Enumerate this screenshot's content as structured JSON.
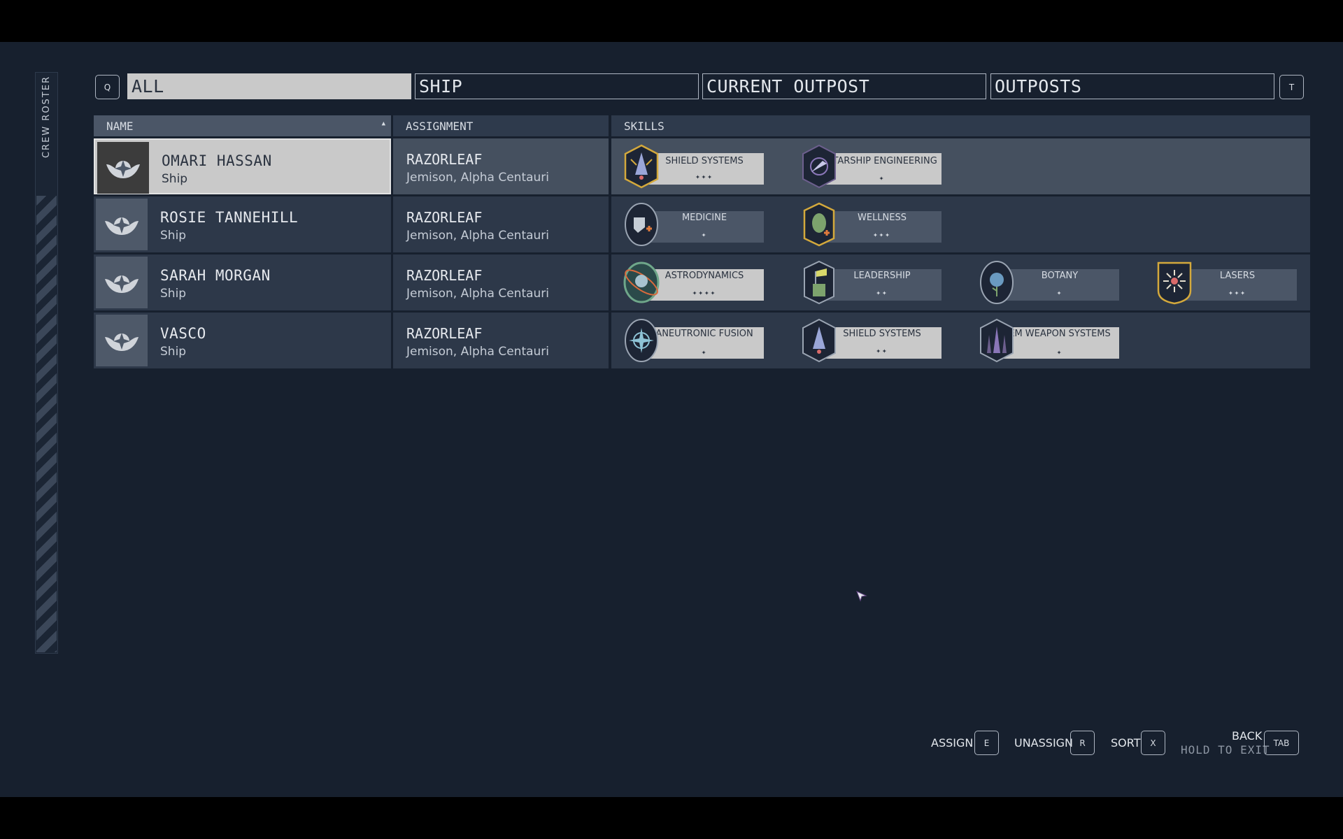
{
  "side_panel": {
    "label": "CREW ROSTER"
  },
  "tabs": {
    "prev_key": "Q",
    "next_key": "T",
    "items": [
      {
        "label": "ALL",
        "active": true
      },
      {
        "label": "SHIP",
        "active": false
      },
      {
        "label": "CURRENT OUTPOST",
        "active": false
      },
      {
        "label": "OUTPOSTS",
        "active": false
      }
    ]
  },
  "table": {
    "headers": {
      "name": "NAME",
      "assignment": "ASSIGNMENT",
      "skills": "SKILLS"
    },
    "rows": [
      {
        "name": "OMARI HASSAN",
        "location": "Ship",
        "ship": "RAZORLEAF",
        "place": "Jemison, Alpha Centauri",
        "selected": true,
        "skills": [
          {
            "name": "SHIELD SYSTEMS",
            "rank": "✦✦✦",
            "rank_value": 3,
            "icon": "shield-systems-patch-icon"
          },
          {
            "name": "STARSHIP ENGINEERING",
            "rank": "✦",
            "rank_value": 1,
            "icon": "starship-engineering-patch-icon"
          }
        ]
      },
      {
        "name": "ROSIE TANNEHILL",
        "location": "Ship",
        "ship": "RAZORLEAF",
        "place": "Jemison, Alpha Centauri",
        "selected": false,
        "skills": [
          {
            "name": "MEDICINE",
            "rank": "✦",
            "rank_value": 1,
            "icon": "medicine-patch-icon"
          },
          {
            "name": "WELLNESS",
            "rank": "✦✦✦",
            "rank_value": 3,
            "icon": "wellness-patch-icon"
          }
        ]
      },
      {
        "name": "SARAH MORGAN",
        "location": "Ship",
        "ship": "RAZORLEAF",
        "place": "Jemison, Alpha Centauri",
        "selected": false,
        "skills": [
          {
            "name": "ASTRODYNAMICS",
            "rank": "✦✦✦✦",
            "rank_value": 4,
            "icon": "astrodynamics-patch-icon"
          },
          {
            "name": "LEADERSHIP",
            "rank": "✦✦",
            "rank_value": 2,
            "icon": "leadership-patch-icon"
          },
          {
            "name": "BOTANY",
            "rank": "✦",
            "rank_value": 1,
            "icon": "botany-patch-icon"
          },
          {
            "name": "LASERS",
            "rank": "✦✦✦",
            "rank_value": 3,
            "icon": "lasers-patch-icon"
          }
        ]
      },
      {
        "name": "VASCO",
        "location": "Ship",
        "ship": "RAZORLEAF",
        "place": "Jemison, Alpha Centauri",
        "selected": false,
        "skills": [
          {
            "name": "ANEUTRONIC FUSION",
            "rank": "✦",
            "rank_value": 1,
            "icon": "aneutronic-fusion-patch-icon"
          },
          {
            "name": "SHIELD SYSTEMS",
            "rank": "✦✦",
            "rank_value": 2,
            "icon": "shield-systems-patch-icon"
          },
          {
            "name": "EM WEAPON SYSTEMS",
            "rank": "✦",
            "rank_value": 1,
            "icon": "em-weapon-systems-patch-icon"
          }
        ]
      }
    ]
  },
  "footer": {
    "assign": {
      "label": "ASSIGN",
      "key": "E"
    },
    "unassign": {
      "label": "UNASSIGN",
      "key": "R"
    },
    "sort": {
      "label": "SORT",
      "key": "X"
    },
    "back": {
      "label": "BACK",
      "sub": "HOLD TO EXIT",
      "key": "TAB"
    }
  },
  "colors": {
    "background": "#17202e",
    "row": "#2d3849",
    "selected": "#c9c9c9",
    "patch_gold": "#d4a93c"
  }
}
